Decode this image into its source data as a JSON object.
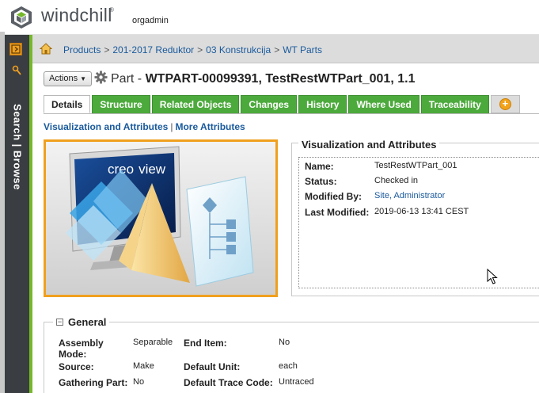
{
  "header": {
    "product_name": "windchill",
    "registered_mark": "®",
    "user": "orgadmin"
  },
  "navigator": {
    "label": "Search | Browse"
  },
  "breadcrumb": {
    "items": [
      "Products",
      "201-2017 Reduktor",
      "03 Konstrukcija",
      "WT Parts"
    ],
    "separator": ">"
  },
  "toolbar": {
    "actions_label": "Actions",
    "title_prefix": "Part -",
    "title_main": "WTPART-00099391, TestRestWTPart_001, 1.1"
  },
  "tabs": [
    {
      "label": "Details",
      "active": true
    },
    {
      "label": "Structure",
      "active": false
    },
    {
      "label": "Related Objects",
      "active": false
    },
    {
      "label": "Changes",
      "active": false
    },
    {
      "label": "History",
      "active": false
    },
    {
      "label": "Where Used",
      "active": false
    },
    {
      "label": "Traceability",
      "active": false
    }
  ],
  "sub_links": {
    "first": "Visualization and Attributes",
    "separator": "|",
    "second": "More Attributes"
  },
  "visualization": {
    "logo_text": "creo",
    "logo_text_2": "view"
  },
  "va_panel": {
    "title": "Visualization and Attributes",
    "rows": [
      {
        "label": "Name:",
        "value": "TestRestWTPart_001",
        "link": false
      },
      {
        "label": "Status:",
        "value": "Checked in",
        "link": false
      },
      {
        "label": "Modified By:",
        "value": "Site, Administrator",
        "link": true
      },
      {
        "label": "Last Modified:",
        "value": "2019-06-13 13:41 CEST",
        "link": false
      }
    ]
  },
  "general": {
    "title": "General",
    "collapse_symbol": "−",
    "assembly_mode_label_1": "Assembly",
    "assembly_mode_label_2": "Mode:",
    "assembly_mode_value": "Separable",
    "end_item_label": "End Item:",
    "end_item_value": "No",
    "source_label": "Source:",
    "source_value": "Make",
    "default_unit_label": "Default Unit:",
    "default_unit_value": "each",
    "gathering_part_label": "Gathering Part:",
    "gathering_part_value": "No",
    "default_trace_code_label": "Default Trace Code:",
    "default_trace_code_value": "Untraced"
  },
  "colors": {
    "tab_green": "#4caa3c",
    "link_blue": "#1a5a9c",
    "viz_border_orange": "#f0a01e",
    "nav_dark": "#3a3d41"
  }
}
